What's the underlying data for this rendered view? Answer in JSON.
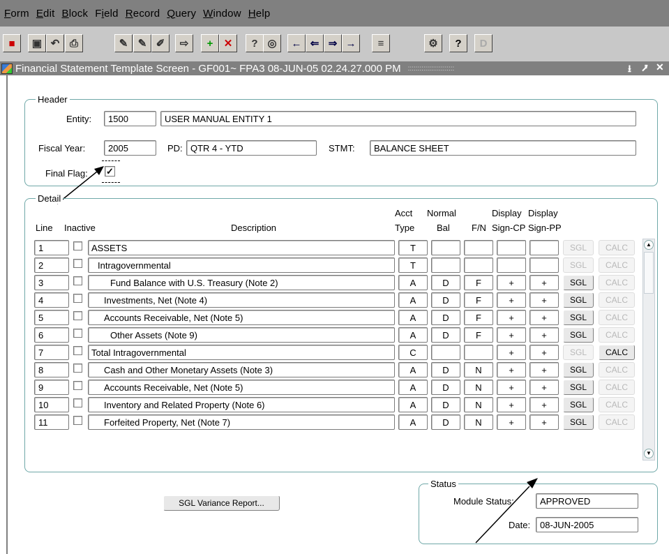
{
  "menu": [
    "Form",
    "Edit",
    "Block",
    "Field",
    "Record",
    "Query",
    "Window",
    "Help"
  ],
  "menu_mnemonic": [
    "F",
    "E",
    "B",
    "i",
    "R",
    "Q",
    "W",
    "H"
  ],
  "toolbar_icons": [
    "exit-icon",
    "save-icon",
    "undo-icon",
    "print-icon",
    "edit-icon",
    "edit-alt-icon",
    "clear-icon",
    "enter-query-icon",
    "insert-record-icon",
    "delete-record-icon",
    "query-icon",
    "count-query-icon",
    "first-record-icon",
    "previous-record-icon",
    "next-record-icon",
    "last-record-icon",
    "list-icon",
    "tools-icon",
    "help-icon",
    "d-icon"
  ],
  "window": {
    "title": "Financial Statement Template Screen - GF001~ FPA3  08-JUN-05 02.24.27.000 PM",
    "dots": "::::::::::::::::::::::::"
  },
  "header": {
    "legend": "Header",
    "entity_label": "Entity:",
    "entity_code": "1500",
    "entity_name": "USER MANUAL ENTITY 1",
    "fiscal_year_label": "Fiscal Year:",
    "fiscal_year": "2005",
    "pd_label": "PD:",
    "pd": "QTR 4 - YTD",
    "stmt_label": "STMT:",
    "stmt": "BALANCE SHEET",
    "final_flag_label": "Final Flag:",
    "final_flag_checked": true
  },
  "detail": {
    "legend": "Detail",
    "col_line": "Line",
    "col_inactive": "Inactive",
    "col_description": "Description",
    "col_acct_type_1": "Acct",
    "col_acct_type_2": "Type",
    "col_normal_bal_1": "Normal",
    "col_normal_bal_2": "Bal",
    "col_fn": "F/N",
    "col_disp_cp_1": "Display",
    "col_disp_cp_2": "Sign-CP",
    "col_disp_pp_1": "Display",
    "col_disp_pp_2": "Sign-PP",
    "sgl_label": "SGL",
    "calc_label": "CALC",
    "rows": [
      {
        "line": "1",
        "description": "ASSETS",
        "indent": 0,
        "acct": "T",
        "bal": "",
        "fn": "",
        "cp": "",
        "pp": "",
        "sgl_enabled": false,
        "calc_enabled": false
      },
      {
        "line": "2",
        "description": "Intragovernmental",
        "indent": 1,
        "acct": "T",
        "bal": "",
        "fn": "",
        "cp": "",
        "pp": "",
        "sgl_enabled": false,
        "calc_enabled": false
      },
      {
        "line": "3",
        "description": "Fund Balance with U.S. Treasury (Note 2)",
        "indent": 3,
        "acct": "A",
        "bal": "D",
        "fn": "F",
        "cp": "+",
        "pp": "+",
        "sgl_enabled": true,
        "calc_enabled": false
      },
      {
        "line": "4",
        "description": "Investments, Net (Note 4)",
        "indent": 2,
        "acct": "A",
        "bal": "D",
        "fn": "F",
        "cp": "+",
        "pp": "+",
        "sgl_enabled": true,
        "calc_enabled": false
      },
      {
        "line": "5",
        "description": "Accounts Receivable, Net (Note 5)",
        "indent": 2,
        "acct": "A",
        "bal": "D",
        "fn": "F",
        "cp": "+",
        "pp": "+",
        "sgl_enabled": true,
        "calc_enabled": false
      },
      {
        "line": "6",
        "description": "Other Assets (Note 9)",
        "indent": 3,
        "acct": "A",
        "bal": "D",
        "fn": "F",
        "cp": "+",
        "pp": "+",
        "sgl_enabled": true,
        "calc_enabled": false
      },
      {
        "line": "7",
        "description": "Total Intragovernmental",
        "indent": 0,
        "acct": "C",
        "bal": "",
        "fn": "",
        "cp": "+",
        "pp": "+",
        "sgl_enabled": false,
        "calc_enabled": true
      },
      {
        "line": "8",
        "description": "Cash and Other Monetary Assets (Note 3)",
        "indent": 2,
        "acct": "A",
        "bal": "D",
        "fn": "N",
        "cp": "+",
        "pp": "+",
        "sgl_enabled": true,
        "calc_enabled": false
      },
      {
        "line": "9",
        "description": "Accounts Receivable, Net (Note 5)",
        "indent": 2,
        "acct": "A",
        "bal": "D",
        "fn": "N",
        "cp": "+",
        "pp": "+",
        "sgl_enabled": true,
        "calc_enabled": false
      },
      {
        "line": "10",
        "description": "Inventory and Related Property (Note 6)",
        "indent": 2,
        "acct": "A",
        "bal": "D",
        "fn": "N",
        "cp": "+",
        "pp": "+",
        "sgl_enabled": true,
        "calc_enabled": false
      },
      {
        "line": "11",
        "description": "Forfeited Property, Net (Note 7)",
        "indent": 2,
        "acct": "A",
        "bal": "D",
        "fn": "N",
        "cp": "+",
        "pp": "+",
        "sgl_enabled": true,
        "calc_enabled": false
      }
    ]
  },
  "sgl_variance_button": "SGL Variance Report...",
  "status": {
    "legend": "Status",
    "module_status_label": "Module Status:",
    "module_status": "APPROVED",
    "date_label": "Date:",
    "date": "08-JUN-2005"
  }
}
